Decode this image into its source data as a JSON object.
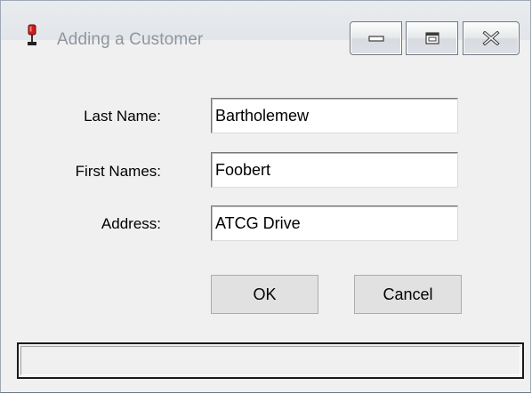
{
  "window": {
    "title": "Adding a Customer",
    "icon": "red-app-icon",
    "controls": [
      "minimize-icon",
      "maximize-icon",
      "close-icon"
    ]
  },
  "form": {
    "last_name": {
      "label": "Last Name:",
      "value": "Bartholemew"
    },
    "first_names": {
      "label": "First Names:",
      "value": "Foobert"
    },
    "address": {
      "label": "Address:",
      "value": "ATCG Drive"
    }
  },
  "buttons": {
    "ok": "OK",
    "cancel": "Cancel"
  },
  "statusbar": {
    "text": ""
  },
  "colors": {
    "window_background": "#f0f0f0",
    "title_text": "#8e96a0",
    "app_icon": "#d21c1c"
  }
}
